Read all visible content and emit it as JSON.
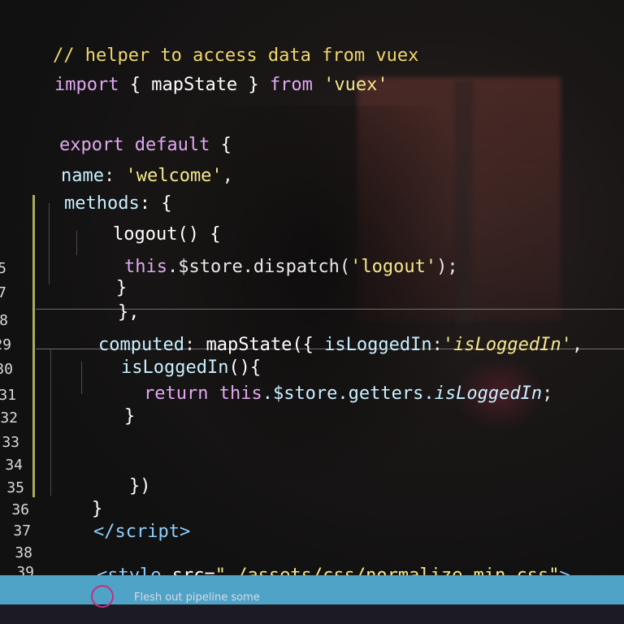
{
  "editor": {
    "lines": [
      {
        "number": "",
        "parts": [
          "// helper to access data from vuex"
        ]
      },
      {
        "number": "",
        "parts": [
          "import",
          " { ",
          "mapState",
          " } ",
          "from",
          " ",
          "'vuex'"
        ]
      },
      {
        "number": "",
        "parts": [
          "export default",
          " {"
        ]
      },
      {
        "number": "",
        "parts": [
          "name",
          ": ",
          "'welcome'",
          ","
        ]
      },
      {
        "number": "",
        "parts": [
          "methods",
          ": {"
        ]
      },
      {
        "number": "",
        "parts": [
          "logout()",
          " {"
        ]
      },
      {
        "number": "",
        "parts": [
          "this",
          ".$store.dispatch(",
          "'logout'",
          ");"
        ]
      },
      {
        "number": "5",
        "parts": [
          "}"
        ]
      },
      {
        "number": "7",
        "parts": [
          "},"
        ]
      },
      {
        "number": "8",
        "parts": [
          "computed",
          ": ",
          "mapState",
          "({ ",
          "isLoggedIn",
          ":",
          "'isLoggedIn'",
          ","
        ]
      },
      {
        "number": "29",
        "parts": [
          "isLoggedIn",
          "(){"
        ]
      },
      {
        "number": "30",
        "parts": [
          "return",
          " ",
          "this",
          ".$store.getters.",
          "isLoggedIn",
          ";"
        ]
      },
      {
        "number": "31",
        "parts": [
          "}"
        ]
      },
      {
        "number": "32",
        "parts": [
          ""
        ]
      },
      {
        "number": "33",
        "parts": [
          ""
        ]
      },
      {
        "number": "34",
        "parts": [
          "})"
        ]
      },
      {
        "number": "35",
        "parts": [
          "}"
        ]
      },
      {
        "number": "36",
        "parts": [
          "</",
          "script",
          ">"
        ]
      },
      {
        "number": "37",
        "parts": [
          ""
        ]
      },
      {
        "number": "38",
        "parts": [
          "<",
          "style",
          " src=",
          "\"./assets/css/normalize.min.css\"",
          ">"
        ]
      },
      {
        "number": "39",
        "parts": [
          ""
        ]
      }
    ]
  },
  "taskbar": {
    "item_text": "Flesh out pipeline some",
    "icon": "app-icon"
  },
  "colors": {
    "comment": "#f0d86a",
    "keyword": "#e0a8f0",
    "string": "#f6e88a",
    "statusbar": "#4fa3c6"
  }
}
